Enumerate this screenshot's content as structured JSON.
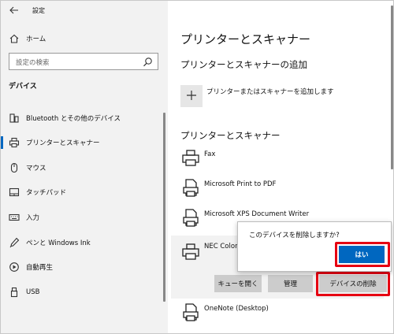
{
  "window": {
    "title": "設定",
    "caption_icons": [
      "minimize-icon",
      "maximize-icon",
      "close-icon"
    ]
  },
  "sidebar": {
    "home_label": "ホーム",
    "search_placeholder": "設定の検索",
    "section_title": "デバイス",
    "items": [
      {
        "label": "Bluetooth とその他のデバイス",
        "icon": "bluetooth-devices-icon"
      },
      {
        "label": "プリンターとスキャナー",
        "icon": "printer-icon",
        "active": true
      },
      {
        "label": "マウス",
        "icon": "mouse-icon"
      },
      {
        "label": "タッチパッド",
        "icon": "touchpad-icon"
      },
      {
        "label": "入力",
        "icon": "keyboard-icon"
      },
      {
        "label": "ペンと Windows Ink",
        "icon": "pen-icon"
      },
      {
        "label": "自動再生",
        "icon": "autoplay-icon"
      },
      {
        "label": "USB",
        "icon": "usb-icon"
      }
    ]
  },
  "main": {
    "page_title": "プリンターとスキャナー",
    "add_section_title": "プリンターとスキャナーの追加",
    "add_label": "プリンターまたはスキャナーを追加します",
    "list_title": "プリンターとスキャナー",
    "printers": [
      {
        "name": "Fax",
        "icon": "printer-icon"
      },
      {
        "name": "Microsoft Print to PDF",
        "icon": "document-printer-icon"
      },
      {
        "name": "Microsoft XPS Document Writer",
        "icon": "document-printer-icon"
      },
      {
        "name": "NEC Color",
        "icon": "printer-icon",
        "selected": true
      },
      {
        "name": "OneNote (Desktop)",
        "icon": "document-printer-icon"
      }
    ],
    "actions": {
      "open_queue": "キューを開く",
      "manage": "管理",
      "remove_device": "デバイスの削除"
    }
  },
  "confirm": {
    "question": "このデバイスを削除しますか?",
    "yes_label": "はい"
  },
  "colors": {
    "accent": "#0067c0",
    "highlight": "#e60012",
    "sidebar_bg": "#f2f2f2",
    "button_bg": "#cccccc"
  }
}
